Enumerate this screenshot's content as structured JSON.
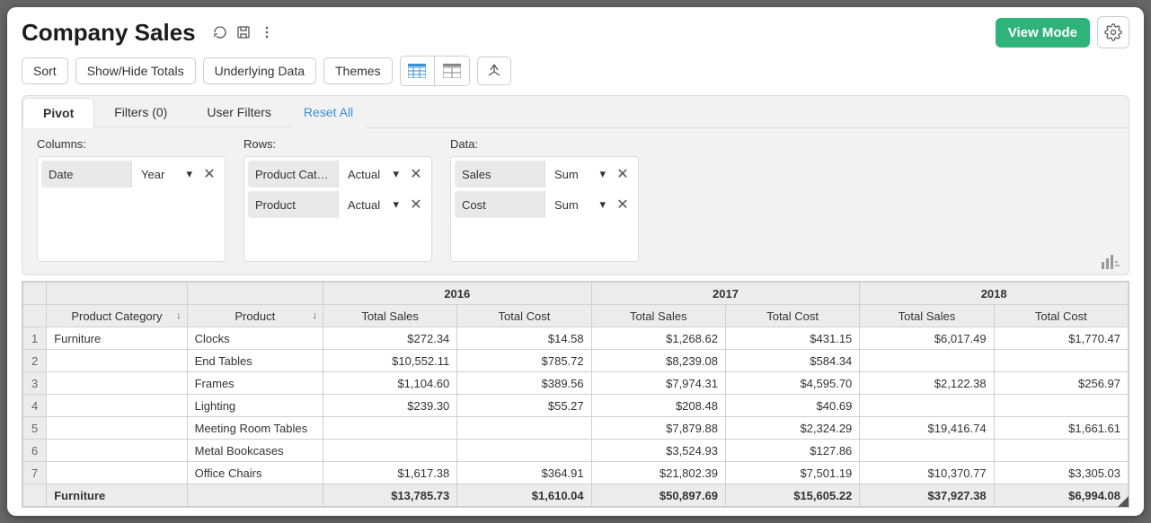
{
  "title": "Company Sales",
  "view_mode_label": "View Mode",
  "toolbar": {
    "sort": "Sort",
    "show_hide": "Show/Hide Totals",
    "underlying": "Underlying Data",
    "themes": "Themes"
  },
  "tabs": {
    "pivot": "Pivot",
    "filters": "Filters (0)",
    "user_filters": "User Filters",
    "reset": "Reset All"
  },
  "config": {
    "columns_label": "Columns:",
    "rows_label": "Rows:",
    "data_label": "Data:",
    "columns": [
      {
        "name": "Date",
        "agg": "Year"
      }
    ],
    "rows": [
      {
        "name": "Product Cate...",
        "agg": "Actual"
      },
      {
        "name": "Product",
        "agg": "Actual"
      }
    ],
    "data": [
      {
        "name": "Sales",
        "agg": "Sum"
      },
      {
        "name": "Cost",
        "agg": "Sum"
      }
    ]
  },
  "grid": {
    "years": [
      "2016",
      "2017",
      "2018"
    ],
    "headers": {
      "cat": "Product Category",
      "prod": "Product",
      "sales": "Total Sales",
      "cost": "Total Cost"
    },
    "category": "Furniture",
    "rows": [
      {
        "n": "1",
        "prod": "Clocks",
        "s16": "$272.34",
        "c16": "$14.58",
        "s17": "$1,268.62",
        "c17": "$431.15",
        "s18": "$6,017.49",
        "c18": "$1,770.47"
      },
      {
        "n": "2",
        "prod": "End Tables",
        "s16": "$10,552.11",
        "c16": "$785.72",
        "s17": "$8,239.08",
        "c17": "$584.34",
        "s18": "",
        "c18": ""
      },
      {
        "n": "3",
        "prod": "Frames",
        "s16": "$1,104.60",
        "c16": "$389.56",
        "s17": "$7,974.31",
        "c17": "$4,595.70",
        "s18": "$2,122.38",
        "c18": "$256.97"
      },
      {
        "n": "4",
        "prod": "Lighting",
        "s16": "$239.30",
        "c16": "$55.27",
        "s17": "$208.48",
        "c17": "$40.69",
        "s18": "",
        "c18": ""
      },
      {
        "n": "5",
        "prod": "Meeting Room Tables",
        "s16": "",
        "c16": "",
        "s17": "$7,879.88",
        "c17": "$2,324.29",
        "s18": "$19,416.74",
        "c18": "$1,661.61"
      },
      {
        "n": "6",
        "prod": "Metal Bookcases",
        "s16": "",
        "c16": "",
        "s17": "$3,524.93",
        "c17": "$127.86",
        "s18": "",
        "c18": ""
      },
      {
        "n": "7",
        "prod": "Office Chairs",
        "s16": "$1,617.38",
        "c16": "$364.91",
        "s17": "$21,802.39",
        "c17": "$7,501.19",
        "s18": "$10,370.77",
        "c18": "$3,305.03"
      }
    ],
    "subtotal": {
      "label": "Furniture",
      "s16": "$13,785.73",
      "c16": "$1,610.04",
      "s17": "$50,897.69",
      "c17": "$15,605.22",
      "s18": "$37,927.38",
      "c18": "$6,994.08"
    }
  }
}
